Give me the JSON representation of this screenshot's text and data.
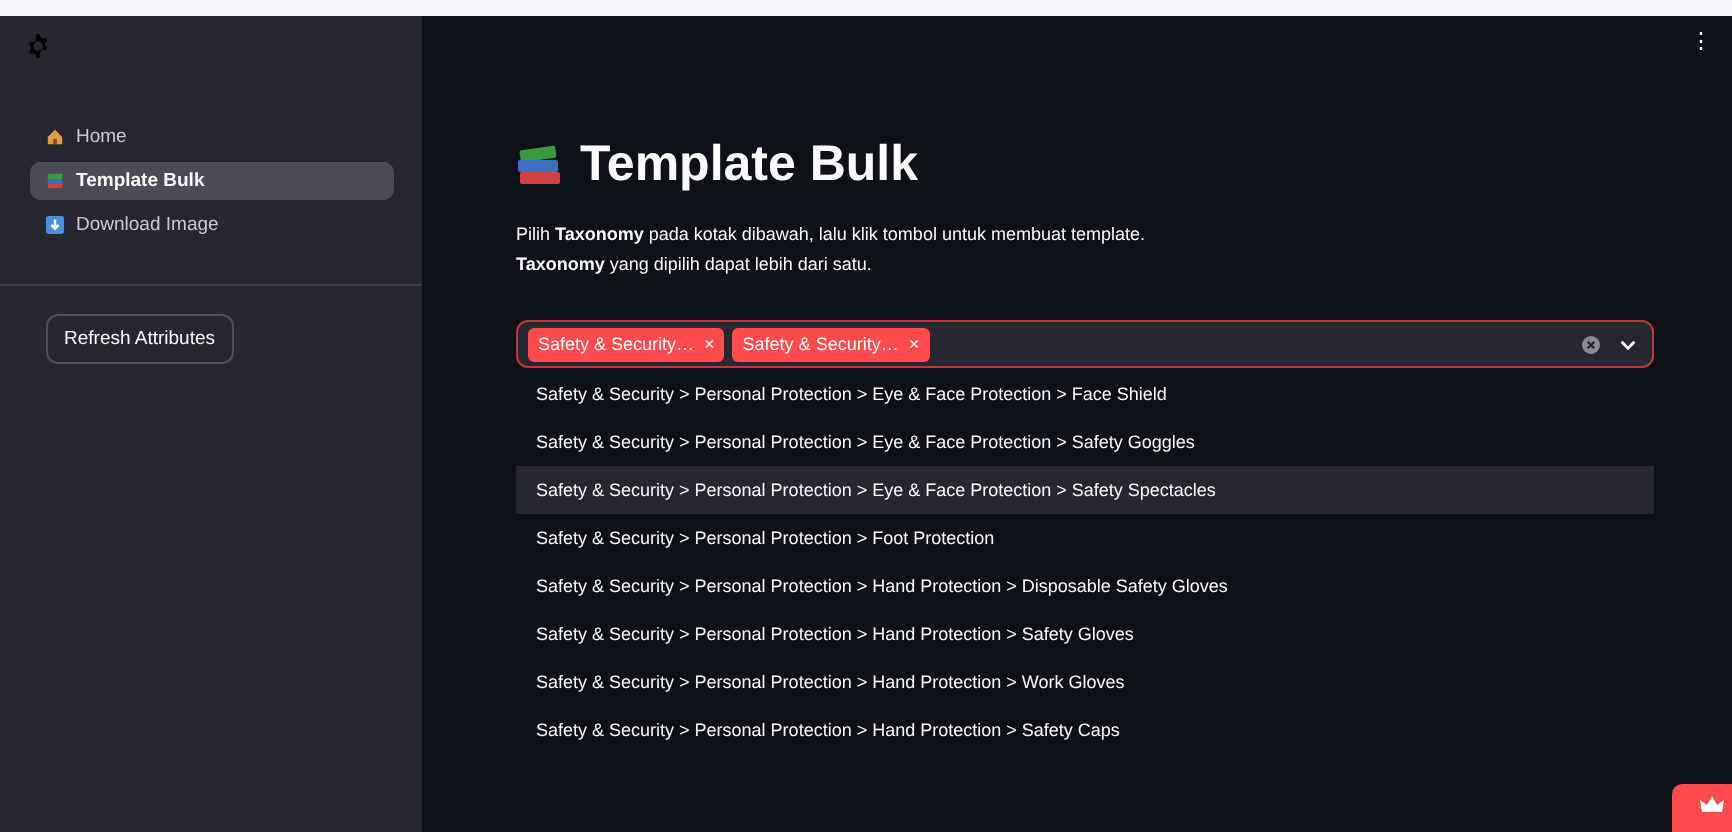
{
  "sidebar": {
    "nav_items": [
      {
        "label": "Home",
        "kind": "house",
        "selected": false
      },
      {
        "label": "Template Bulk",
        "kind": "books",
        "selected": true
      },
      {
        "label": "Download Image",
        "kind": "download",
        "selected": false
      }
    ],
    "refresh_button": "Refresh Attributes"
  },
  "main": {
    "title": "Template Bulk",
    "description": [
      "Pilih **Taxonomy** pada kotak dibawah, lalu klik tombol untuk membuat template.",
      "**Taxonomy** yang dipilih dapat lebih dari satu."
    ],
    "multiselect": {
      "tags": [
        "Safety & Security…",
        "Safety & Security…"
      ],
      "tag_remove": "×",
      "options": [
        {
          "label": "Safety & Security > Personal Protection > Eye & Face Protection > Face Shield",
          "selected": false
        },
        {
          "label": "Safety & Security > Personal Protection > Eye & Face Protection > Safety Goggles",
          "selected": false
        },
        {
          "label": "Safety & Security > Personal Protection > Eye & Face Protection > Safety Spectacles",
          "selected": true
        },
        {
          "label": "Safety & Security > Personal Protection > Foot Protection",
          "selected": false
        },
        {
          "label": "Safety & Security > Personal Protection > Hand Protection > Disposable Safety Gloves",
          "selected": false
        },
        {
          "label": "Safety & Security > Personal Protection > Hand Protection > Safety Gloves",
          "selected": false
        },
        {
          "label": "Safety & Security > Personal Protection > Hand Protection > Work Gloves",
          "selected": false
        },
        {
          "label": "Safety & Security > Personal Protection > Hand Protection > Safety Caps",
          "selected": false
        }
      ]
    }
  },
  "menu_button": "⋮"
}
